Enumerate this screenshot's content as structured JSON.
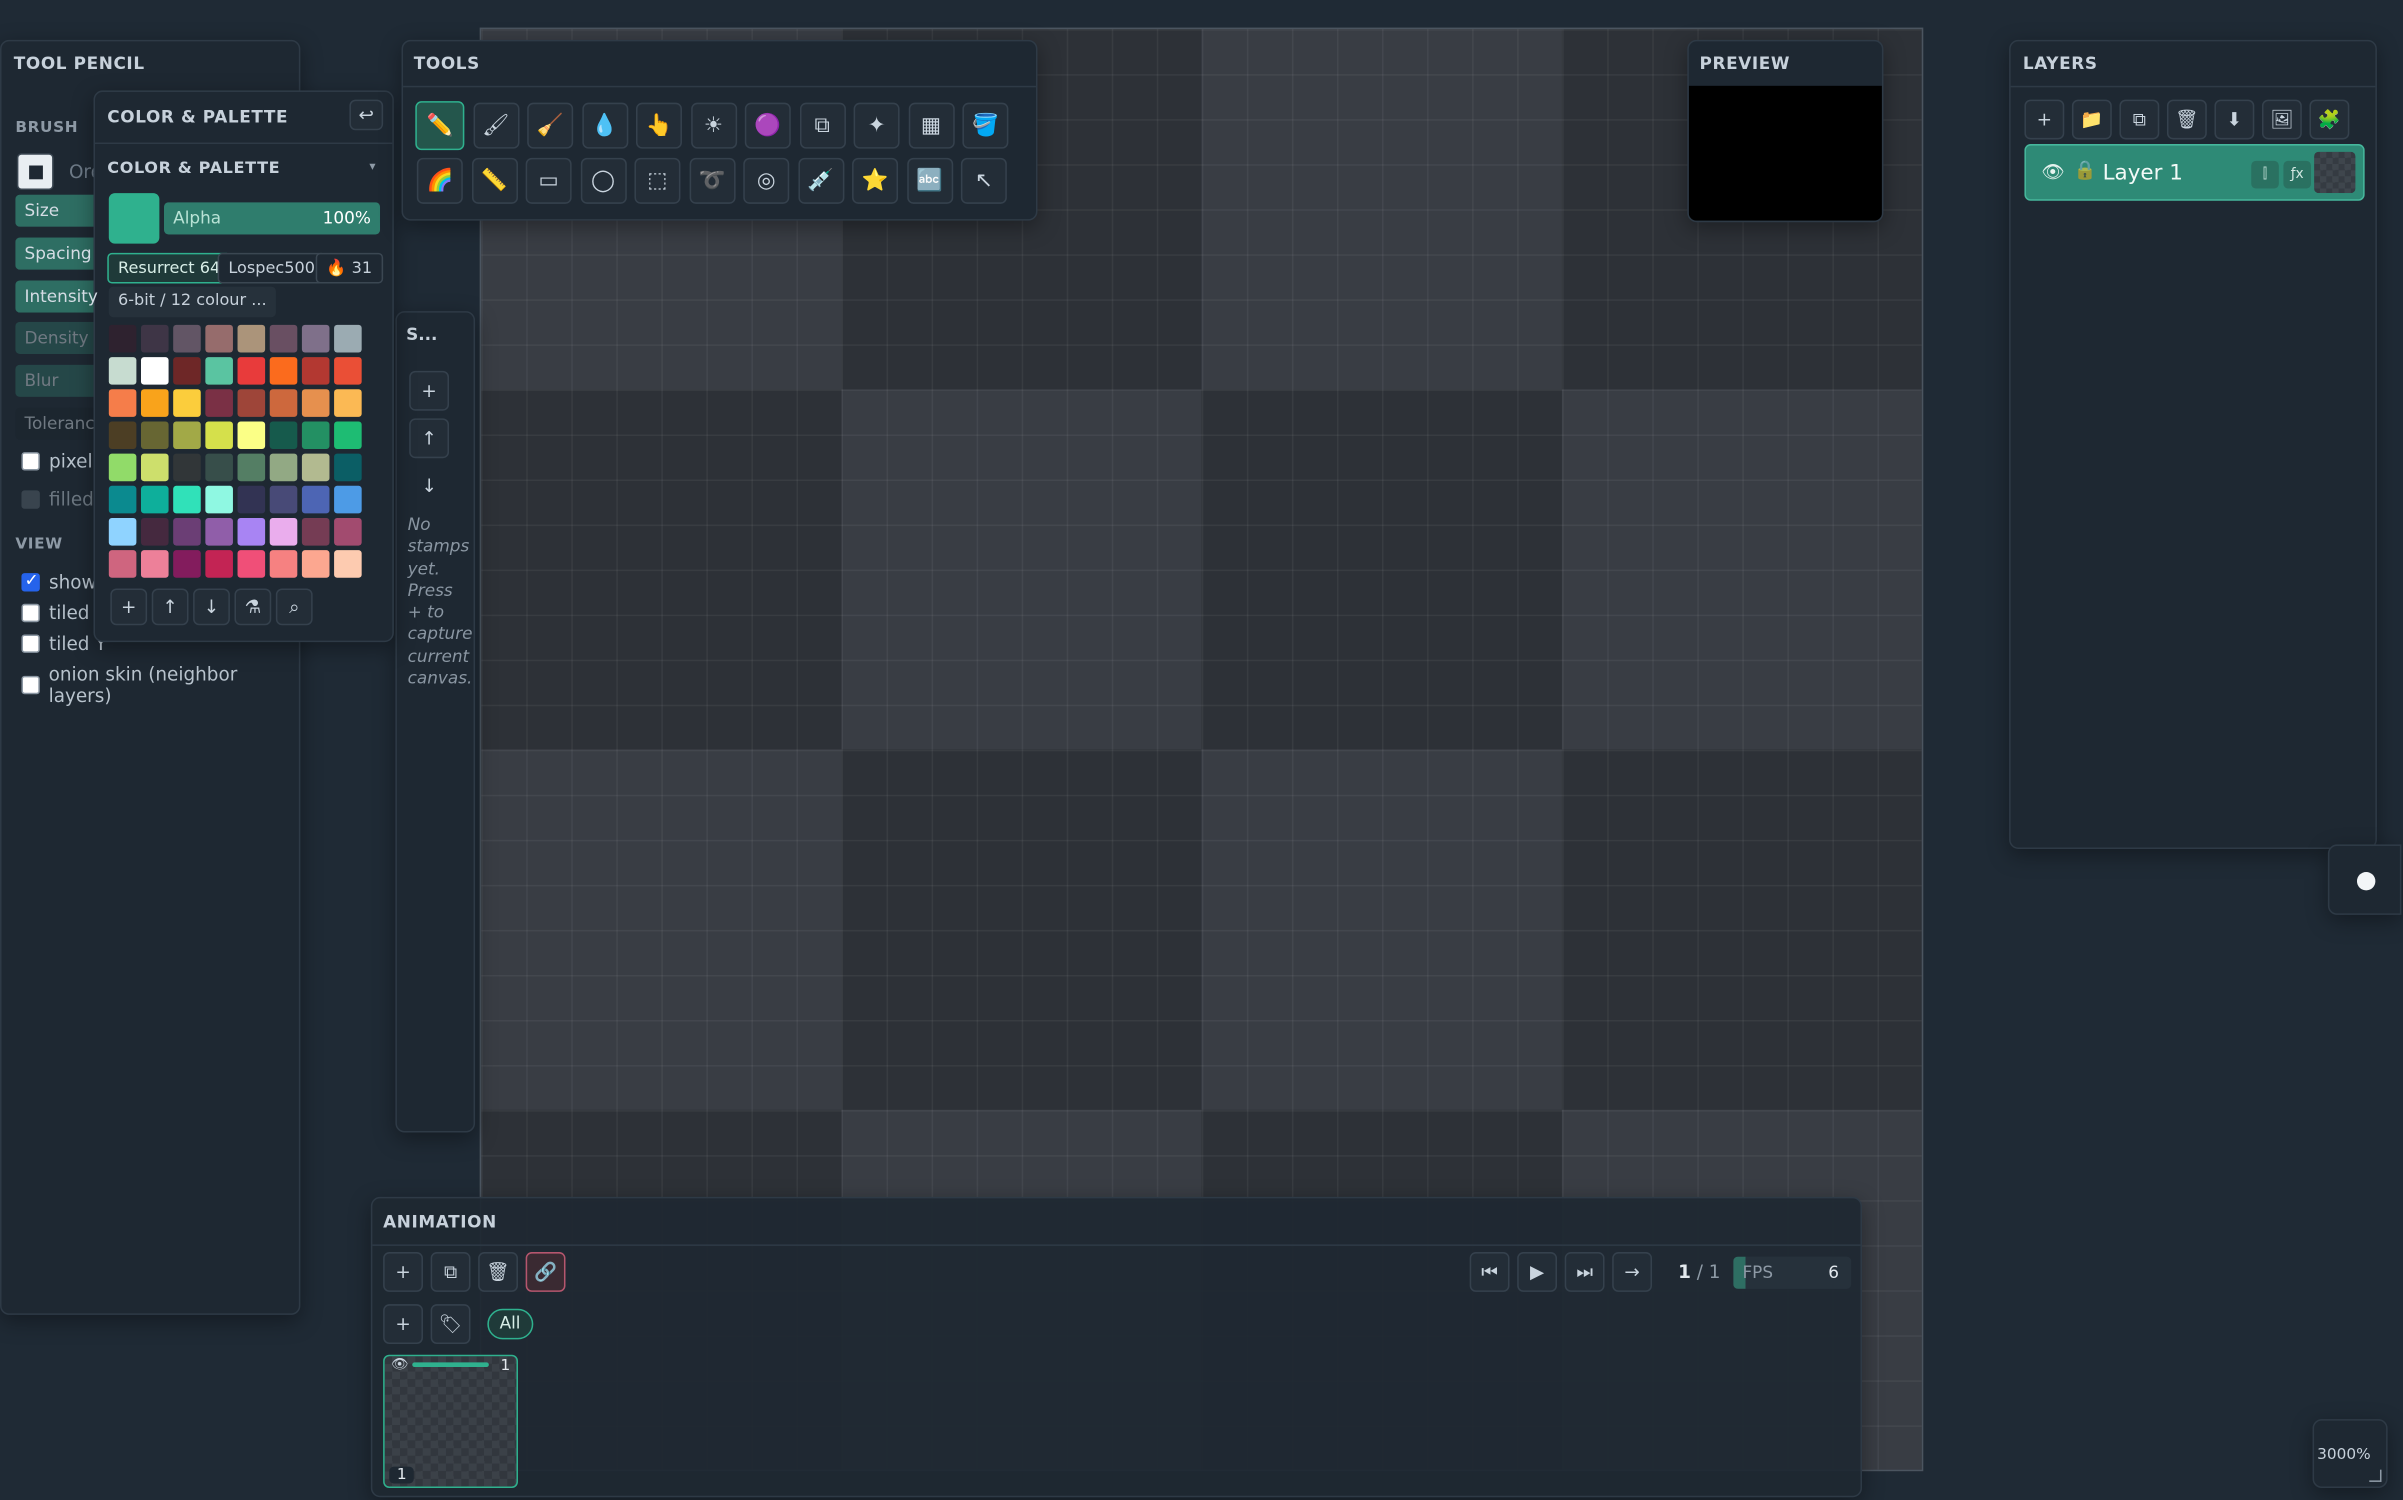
{
  "canvas": {
    "zoom": "3000%"
  },
  "tool_panel": {
    "title": "TOOL PENCIL",
    "brush_section": "BRUSH",
    "brush_shape_partial": "Ord",
    "sliders": [
      "Size",
      "Spacing",
      "Intensity",
      "Density",
      "Blur radius",
      "Tolerance"
    ],
    "options": [
      {
        "label": "pixel-p",
        "checked": false
      },
      {
        "label": "filled s",
        "checked": false
      }
    ],
    "view_section": "VIEW",
    "view_options": [
      {
        "label": "show c",
        "checked": true
      },
      {
        "label": "tiled X",
        "checked": false
      },
      {
        "label": "tiled Y",
        "checked": false
      },
      {
        "label": "onion skin (neighbor layers)",
        "checked": false
      }
    ]
  },
  "color_panel": {
    "title": "COLOR & PALETTE",
    "subtitle": "COLOR & PALETTE",
    "primary_color": "#2fb18e",
    "alpha_label": "Alpha",
    "alpha_value": "100%",
    "alpha_fraction": 1.0,
    "palette_tabs": [
      "Resurrect 64",
      "Lospec500"
    ],
    "palette_count": "31",
    "palette_note": "6-bit / 12 colour ...",
    "swatches": [
      "#2e222f",
      "#3e3546",
      "#625565",
      "#966c6c",
      "#ab947a",
      "#694f62",
      "#7f708a",
      "#9babb2",
      "#c7dcd0",
      "#ffffff",
      "#6e2727",
      "#5ac4a1",
      "#e83b3b",
      "#fb6b1d",
      "#b33831",
      "#ea4f36",
      "#f57d4a",
      "#f9a31b",
      "#fbcd3c",
      "#7a3045",
      "#9e4539",
      "#cd683d",
      "#e6904e",
      "#fbb954",
      "#4c3e24",
      "#676633",
      "#a2a947",
      "#d5e04b",
      "#fbff86",
      "#165a4c",
      "#239063",
      "#1ebc73",
      "#91db69",
      "#cddf6c",
      "#313638",
      "#374e4a",
      "#547e64",
      "#92a984",
      "#b2ba90",
      "#0b5e65",
      "#0b8a8f",
      "#0eaf9b",
      "#30e1b9",
      "#8ff8e2",
      "#323353",
      "#484a77",
      "#4d65b4",
      "#4d9be6",
      "#8fd3ff",
      "#45293f",
      "#6b3e75",
      "#905ea9",
      "#a884f3",
      "#eaaded",
      "#753c54",
      "#a24b6f",
      "#cf657f",
      "#ed8099",
      "#831c5d",
      "#c32454",
      "#f04f78",
      "#f68181",
      "#fca790",
      "#fdcbb0"
    ],
    "footer_buttons": [
      "+",
      "↑",
      "↓",
      "⚗",
      "⌕"
    ]
  },
  "tools": {
    "title": "TOOLS",
    "row1": [
      "✏️",
      "🖌",
      "🧹",
      "💧",
      "👆",
      "☀",
      "🟣",
      "⧉",
      "✦",
      "▦",
      "🪣"
    ],
    "row2": [
      "🌈",
      "📏",
      "▭",
      "◯",
      "⬚",
      "➰",
      "◎",
      "💉",
      "⭐",
      "🔤",
      "↖"
    ]
  },
  "stamps": {
    "title": "S...",
    "buttons": [
      "+",
      "↑",
      "↓"
    ],
    "empty_text": "No stamps yet. Press + to capture current canvas."
  },
  "preview": {
    "title": "PREVIEW"
  },
  "layers": {
    "title": "LAYERS",
    "toolbar": [
      "+",
      "📁",
      "⧉",
      "🗑",
      "⬇",
      "🖼",
      "🧩"
    ],
    "items": [
      {
        "name": "Layer 1",
        "fx": "ƒx"
      }
    ]
  },
  "animation": {
    "title": "ANIMATION",
    "frame_current": "1",
    "frame_total": "1",
    "fps_label": "FPS",
    "fps_value": "6",
    "fps_fraction": 0.1,
    "filter_all": "All",
    "frames": [
      {
        "index": "1",
        "badge": "1"
      }
    ]
  }
}
